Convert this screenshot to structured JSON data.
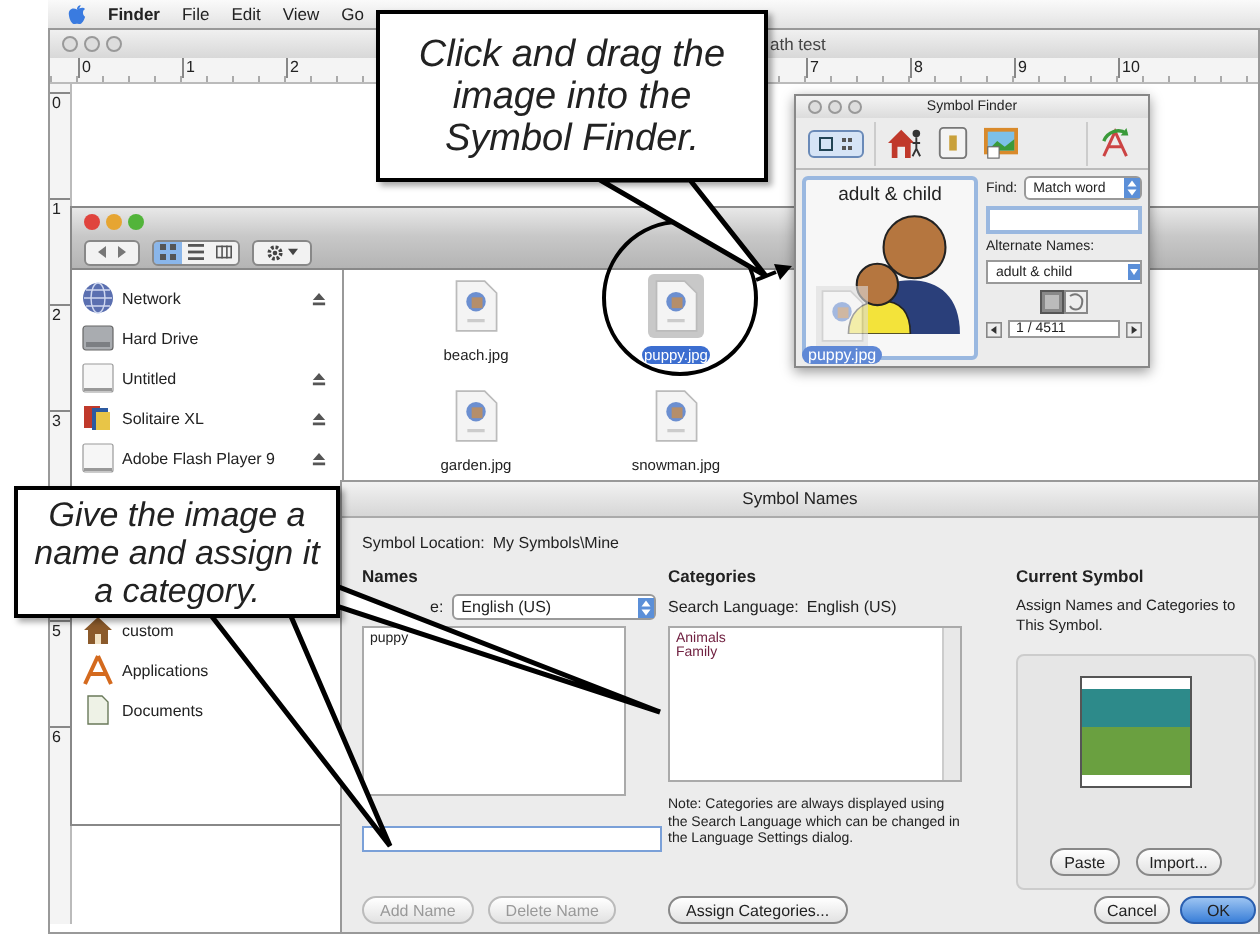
{
  "menu_bar": {
    "items": [
      "Finder",
      "File",
      "Edit",
      "View",
      "Go"
    ]
  },
  "document_window": {
    "title": "ath test",
    "top_ruler_start": [
      "0",
      "1",
      "2"
    ],
    "top_ruler_end": [
      "7",
      "8",
      "9",
      "10"
    ],
    "side_ruler_start": [
      "0",
      "1",
      "2",
      "3"
    ],
    "side_ruler_end": [
      "5",
      "6"
    ]
  },
  "finder_window": {
    "view_buttons": [
      {
        "kind": "icon",
        "selected": true
      },
      {
        "kind": "list",
        "selected": false
      },
      {
        "kind": "columns",
        "selected": false
      }
    ],
    "devices": [
      {
        "label": "Network",
        "kind": "network",
        "eject": true
      },
      {
        "label": "Hard Drive",
        "kind": "drive",
        "eject": false
      },
      {
        "label": "Untitled",
        "kind": "disk",
        "eject": true
      },
      {
        "label": "Solitaire XL",
        "kind": "game",
        "eject": true
      },
      {
        "label": "Adobe Flash Player 9",
        "kind": "disk",
        "eject": true
      }
    ],
    "places": [
      {
        "label": "custom",
        "kind": "home",
        "eject": false
      },
      {
        "label": "Applications",
        "kind": "apps",
        "eject": false
      },
      {
        "label": "Documents",
        "kind": "doc",
        "eject": false
      }
    ],
    "files": [
      {
        "name": "beach.jpg",
        "selected": false
      },
      {
        "name": "puppy.jpg",
        "selected": true
      },
      {
        "name": "garden.jpg",
        "selected": false
      },
      {
        "name": "snowman.jpg",
        "selected": false
      }
    ]
  },
  "symbol_finder": {
    "title": "Symbol Finder",
    "symbol_name": "adult & child",
    "find_label": "Find:",
    "find_mode": "Match word",
    "alternate_names_label": "Alternate Names:",
    "alternate_name": "adult & child",
    "page": "1 / 4511",
    "dragged_file": "puppy.jpg"
  },
  "symbol_names_dialog": {
    "title": "Symbol Names",
    "location_label": "Symbol Location:",
    "location": "My Symbols\\Mine",
    "names_header": "Names",
    "language_label": "e:",
    "language": "English (US)",
    "names": [
      "puppy"
    ],
    "name_buttons": [
      {
        "label": "Add Name",
        "disabled": true
      },
      {
        "label": "Delete Name",
        "disabled": true
      }
    ],
    "categories_header": "Categories",
    "search_language_label": "Search Language:",
    "search_language": "English (US)",
    "categories": [
      "Animals",
      "Family"
    ],
    "note": "Note: Categories are always displayed using the Search Language which can be changed in the Language Settings dialog.",
    "assign_button": "Assign Categories...",
    "current_symbol_header": "Current Symbol",
    "current_symbol_text": "Assign Names and Categories to This Symbol.",
    "paste_button": "Paste",
    "import_button": "Import...",
    "dialog_buttons": [
      {
        "label": "Cancel",
        "default": false
      },
      {
        "label": "OK",
        "default": true
      }
    ]
  },
  "callouts": [
    {
      "lines": [
        "Click and drag the",
        "image into the",
        "Symbol Finder."
      ]
    },
    {
      "lines": [
        "Give the image a",
        "name and assign it",
        "a category."
      ]
    }
  ]
}
